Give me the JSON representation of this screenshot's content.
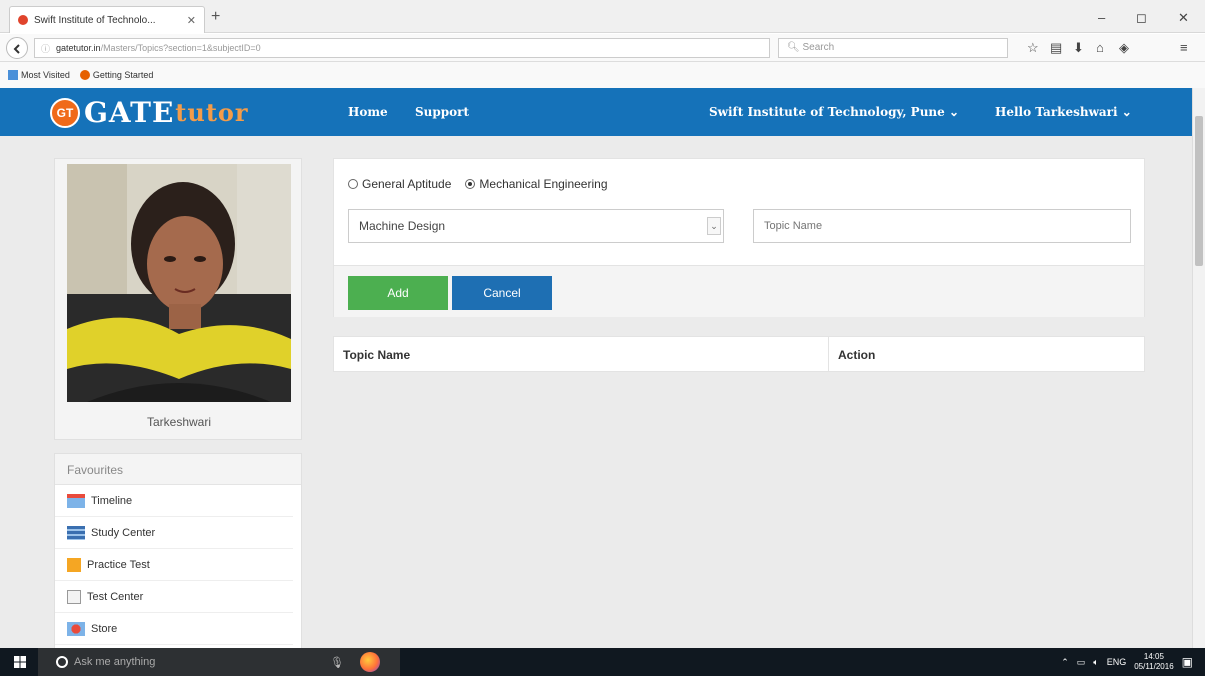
{
  "browser": {
    "tab_title": "Swift Institute of Technolo...",
    "tab_close": "✕",
    "new_tab": "+",
    "url_host": "gatetutor.in",
    "url_path": "/Masters/Topics?section=1&subjectID=0",
    "search_placeholder": "Search",
    "bookmarks": [
      "Most Visited",
      "Getting Started"
    ],
    "window_controls": [
      "–",
      "◻",
      "✕"
    ]
  },
  "header": {
    "logo_badge": "GT",
    "logo_gate": "GATE",
    "logo_tutor": "tutor",
    "nav": [
      "Home",
      "Support"
    ],
    "institute": "Swift Institute of Technology, Pune ⌄",
    "user": "Hello Tarkeshwari ⌄",
    "brand_color": "#1572b9"
  },
  "profile": {
    "name": "Tarkeshwari"
  },
  "favourites": {
    "title": "Favourites",
    "items": [
      {
        "label": "Timeline",
        "icon": "timeline-icon"
      },
      {
        "label": "Study Center",
        "icon": "study-center-icon"
      },
      {
        "label": "Practice Test",
        "icon": "practice-test-icon"
      },
      {
        "label": "Test Center",
        "icon": "test-center-icon"
      },
      {
        "label": "Store",
        "icon": "store-icon"
      }
    ]
  },
  "form": {
    "radio_options": [
      {
        "label": "General Aptitude",
        "selected": false
      },
      {
        "label": "Mechanical Engineering",
        "selected": true
      }
    ],
    "subject_selected": "Machine Design",
    "topic_placeholder": "Topic Name",
    "add_label": "Add",
    "cancel_label": "Cancel"
  },
  "table": {
    "columns": [
      "Topic Name",
      "Action"
    ]
  },
  "taskbar": {
    "search_placeholder": "Ask me anything",
    "language": "ENG",
    "time": "14:05",
    "date": "05/11/2016"
  }
}
